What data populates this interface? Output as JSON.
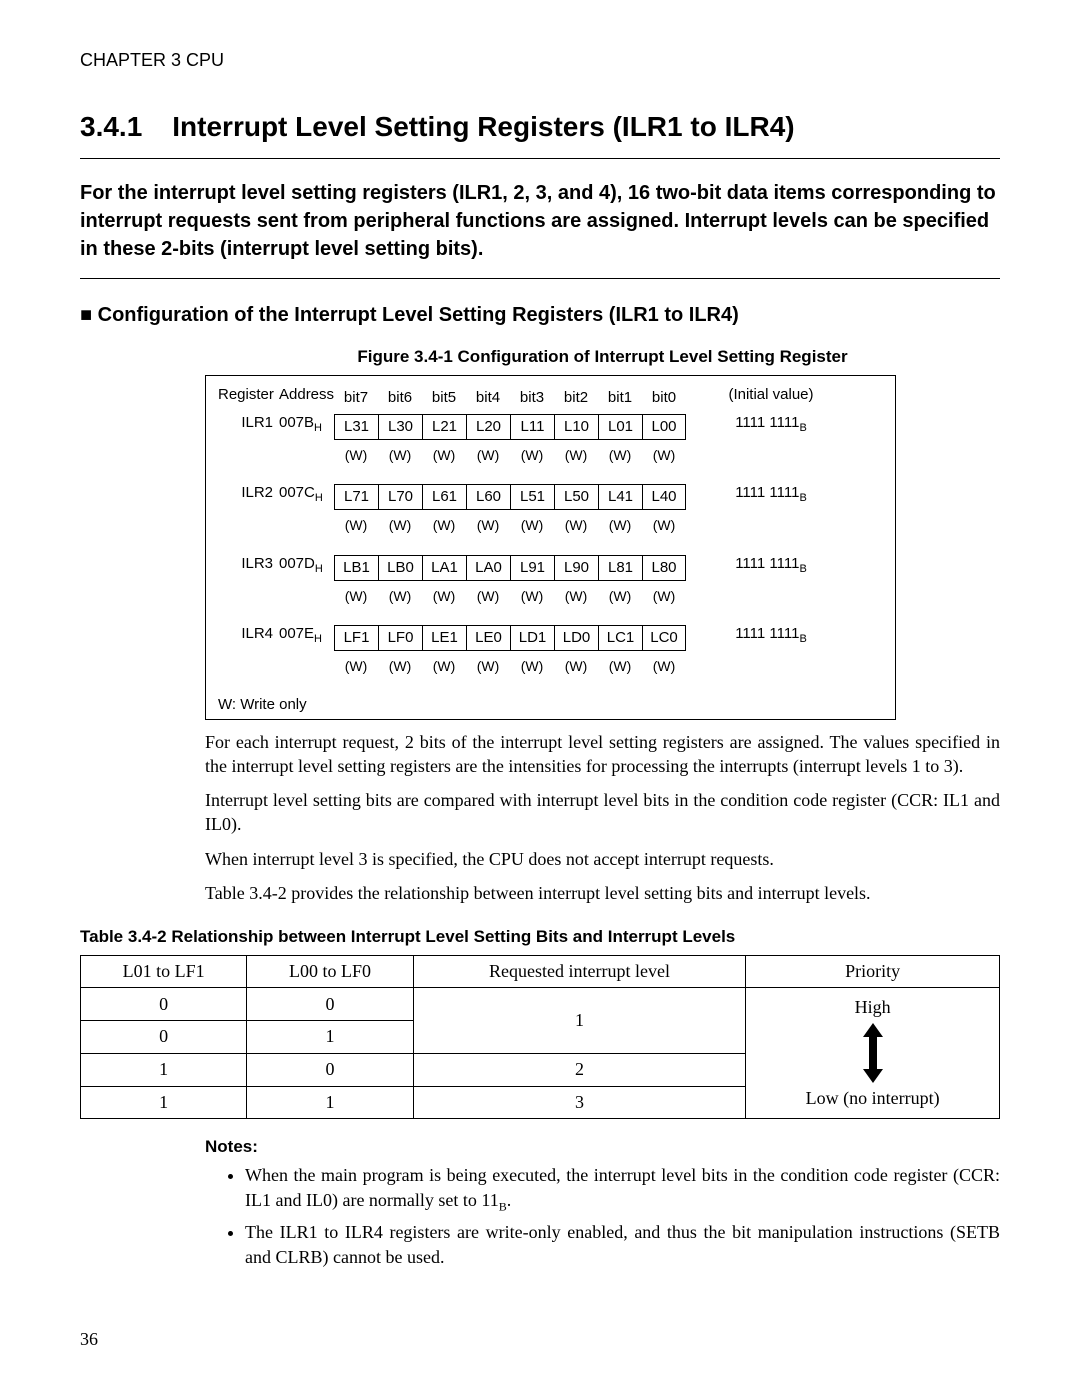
{
  "header": {
    "chapter": "CHAPTER 3  CPU"
  },
  "section": {
    "number": "3.4.1",
    "title": "Interrupt Level Setting Registers (ILR1 to ILR4)"
  },
  "intro": "For the interrupt level setting registers (ILR1, 2, 3, and 4), 16 two-bit data items corresponding to interrupt requests sent from peripheral functions are assigned. Interrupt levels can be specified in these 2-bits (interrupt level setting bits).",
  "subheading": "■  Configuration of the Interrupt Level Setting Registers (ILR1 to ILR4)",
  "fig_caption": "Figure 3.4-1  Configuration of Interrupt Level Setting Register",
  "regtable": {
    "head": {
      "register": "Register",
      "address": "Address",
      "bits": [
        "bit7",
        "bit6",
        "bit5",
        "bit4",
        "bit3",
        "bit2",
        "bit1",
        "bit0"
      ],
      "initial": "(Initial value)"
    },
    "rows": [
      {
        "name": "ILR1",
        "addr": "007B",
        "addr_sub": "H",
        "bits": [
          "L31",
          "L30",
          "L21",
          "L20",
          "L11",
          "L10",
          "L01",
          "L00"
        ],
        "init": "1111 1111",
        "init_sub": "B"
      },
      {
        "name": "ILR2",
        "addr": "007C",
        "addr_sub": "H",
        "bits": [
          "L71",
          "L70",
          "L61",
          "L60",
          "L51",
          "L50",
          "L41",
          "L40"
        ],
        "init": "1111 1111",
        "init_sub": "B"
      },
      {
        "name": "ILR3",
        "addr": "007D",
        "addr_sub": "H",
        "bits": [
          "LB1",
          "LB0",
          "LA1",
          "LA0",
          "L91",
          "L90",
          "L81",
          "L80"
        ],
        "init": "1111 1111",
        "init_sub": "B"
      },
      {
        "name": "ILR4",
        "addr": "007E",
        "addr_sub": "H",
        "bits": [
          "LF1",
          "LF0",
          "LE1",
          "LE0",
          "LD1",
          "LD0",
          "LC1",
          "LC0"
        ],
        "init": "1111 1111",
        "init_sub": "B"
      }
    ],
    "w": "(W)",
    "footnote": "W:  Write only"
  },
  "paras": [
    "For each interrupt request, 2 bits of the interrupt level setting registers are assigned. The values specified in the interrupt level setting registers are the intensities for processing the interrupts (interrupt levels 1 to 3).",
    "Interrupt level setting bits are compared with interrupt level bits in the condition code register (CCR: IL1 and IL0).",
    "When interrupt level 3 is specified, the CPU does not accept interrupt requests.",
    "Table 3.4-2 provides the relationship between interrupt level setting bits and interrupt levels."
  ],
  "table_caption": "Table 3.4-2  Relationship between Interrupt Level Setting Bits and Interrupt Levels",
  "rel_table": {
    "headers": [
      "L01 to LF1",
      "L00 to LF0",
      "Requested interrupt level",
      "Priority"
    ],
    "rows": [
      {
        "c0": "0",
        "c1": "0"
      },
      {
        "c0": "0",
        "c1": "1"
      },
      {
        "c0": "1",
        "c1": "0"
      },
      {
        "c0": "1",
        "c1": "1"
      }
    ],
    "level_merged": [
      "1",
      "2",
      "3"
    ],
    "priority_high": "High",
    "priority_low": "Low (no interrupt)"
  },
  "notes_head": "Notes:",
  "notes": [
    {
      "pre": "When the main program is being executed, the interrupt level bits in the condition code register (CCR: IL1 and IL0) are normally set to 11",
      "sub": "B",
      "post": "."
    },
    {
      "pre": "The ILR1 to ILR4 registers are write-only enabled, and thus the bit manipulation instructions (SETB and CLRB) cannot be used.",
      "sub": "",
      "post": ""
    }
  ],
  "page": "36"
}
